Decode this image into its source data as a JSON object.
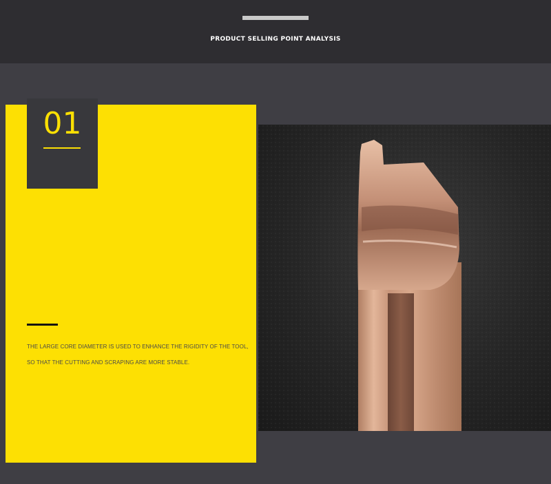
{
  "header": {
    "title": "PRODUCT SELLING POINT ANALYSIS"
  },
  "feature": {
    "number": "01",
    "description_lines": [
      "THE LARGE CORE DIAMETER IS USED TO ENHANCE THE RIGIDITY OF THE TOOL,",
      "SO THAT THE CUTTING AND SCRAPING ARE MORE STABLE."
    ]
  },
  "colors": {
    "accent_yellow": "#fde003",
    "header_dark": "#2e2d31",
    "background": "#3f3e44",
    "tool_bronze": "#c9977a"
  },
  "image": {
    "subject": "bronze-coated boring tool tip on dark textured background"
  }
}
